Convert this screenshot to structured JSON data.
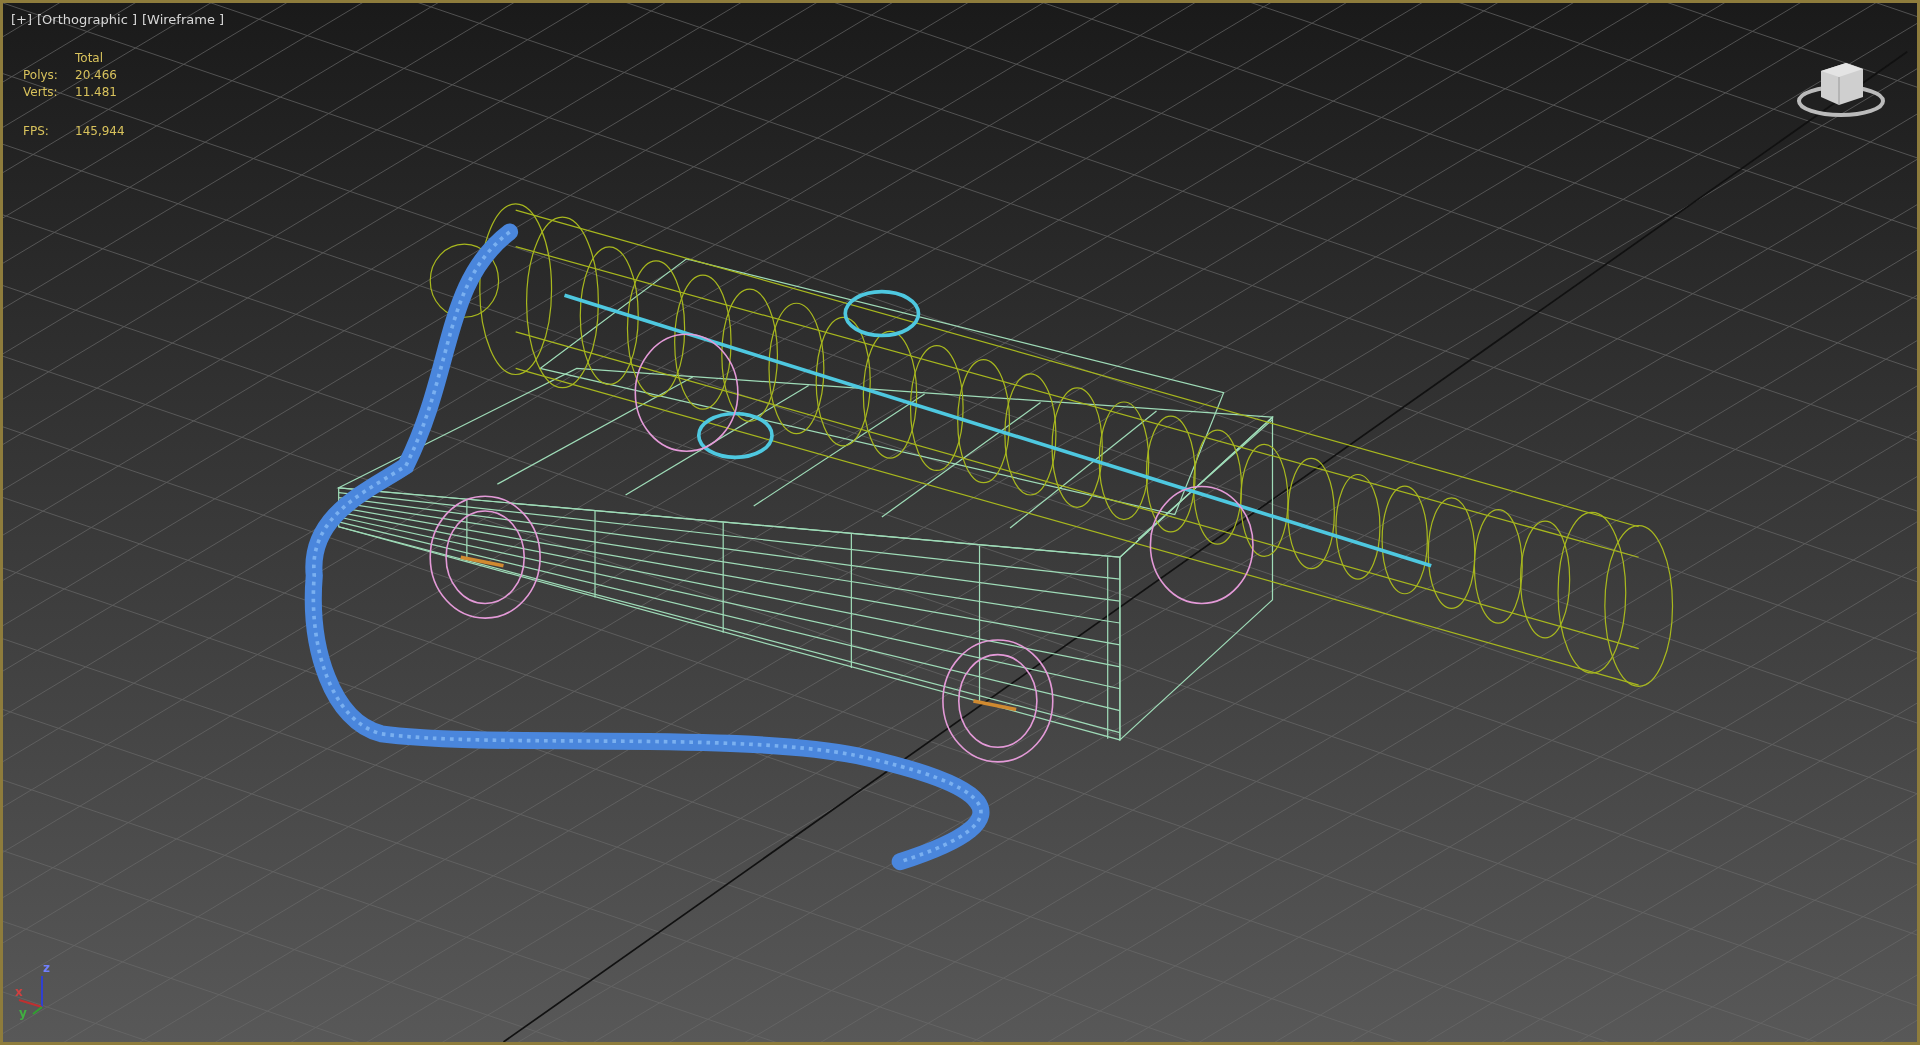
{
  "viewport": {
    "labels": [
      {
        "text": "[+]"
      },
      {
        "text": "[Orthographic ]"
      },
      {
        "text": "[Wireframe ]"
      }
    ],
    "stats": {
      "header": "Total",
      "rows": [
        {
          "label": "Polys:",
          "value": "20.466"
        },
        {
          "label": "Verts:",
          "value": "11.481"
        }
      ],
      "fps": {
        "label": "FPS:",
        "value": "145,944"
      }
    },
    "axis_labels": {
      "z": "z",
      "x": "x",
      "y": "y"
    }
  }
}
